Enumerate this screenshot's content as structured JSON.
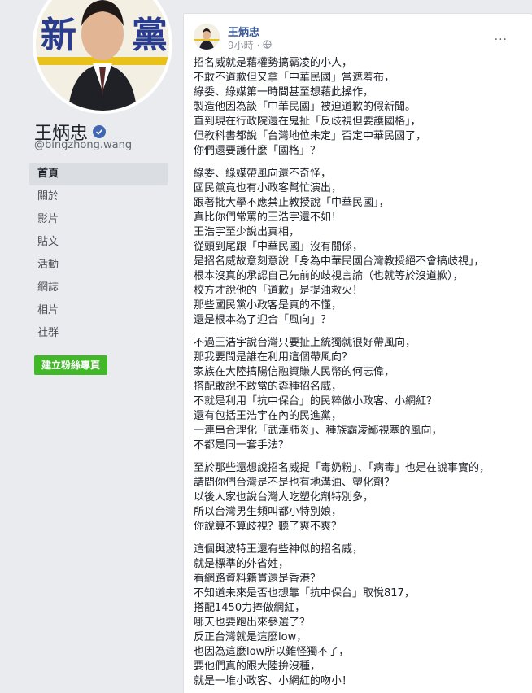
{
  "profile": {
    "name": "王炳忠",
    "handle": "@bingzhong.wang"
  },
  "nav": [
    {
      "label": "首頁",
      "active": true
    },
    {
      "label": "關於",
      "active": false
    },
    {
      "label": "影片",
      "active": false
    },
    {
      "label": "貼文",
      "active": false
    },
    {
      "label": "活動",
      "active": false
    },
    {
      "label": "網誌",
      "active": false
    },
    {
      "label": "相片",
      "active": false
    },
    {
      "label": "社群",
      "active": false
    }
  ],
  "create_page_button": "建立粉絲專頁",
  "post": {
    "author": "王炳忠",
    "time": "9小時",
    "more": "···",
    "paragraphs": [
      [
        "招名威就是藉權勢搞霸凌的小人，",
        "不敢不道歉但又拿「中華民國」當遮羞布，",
        "綠委、綠媒第一時間甚至想藉此操作，",
        "製造他因為談「中華民國」被迫道歉的假新聞。",
        "直到現在行政院還在鬼扯「反歧視但要護國格」，",
        "但教科書都說「台灣地位未定」否定中華民國了，",
        "你們還要護什麼「國格」？"
      ],
      [
        "綠委、綠媒帶風向還不奇怪，",
        "國民黨竟也有小政客幫忙演出，",
        "跟著批大學不應禁止教授說「中華民國」，",
        "真比你們常罵的王浩宇還不如！",
        "王浩宇至少說出真相，",
        "從頭到尾跟「中華民國」沒有關係，",
        "是招名威故意刻意說「身為中華民國台灣教授絕不會搞歧視」，",
        "根本沒真的承認自己先前的歧視言論（也就等於沒道歉），",
        "校方才說他的「道歉」是提油救火！",
        "那些國民黨小政客是真的不懂，",
        "還是根本為了迎合「風向」？"
      ],
      [
        "不過王浩宇說台灣只要扯上統獨就很好帶風向，",
        "那我要問是誰在利用這個帶風向？",
        "家族在大陸搞陽信融資賺人民幣的何志偉，",
        "搭配敢說不敢當的孬種招名威，",
        "不就是利用「抗中保台」的民粹做小政客、小網紅？",
        "還有包括王浩宇在內的民進黨，",
        "一連串合理化「武漢肺炎」、種族霸凌鄙視塞的風向，",
        "不都是同一套手法？"
      ],
      [
        "至於那些還想說招名威提「毒奶粉」、「病毒」也是在說事實的，",
        "請問你們台灣是不是也有地溝油、塑化劑？",
        "以後人家也說台灣人吃塑化劑特別多，",
        "所以台灣男生頻叫都小特別娘，",
        "你說算不算歧視？聽了爽不爽？"
      ],
      [
        "這個與波特王還有些神似的招名威，",
        "就是標準的外省姓，",
        "看網路資料籍貫還是香港？",
        "不知道未來是否也想靠「抗中保台」取悅817，",
        "搭配1450力捧做網紅，",
        "哪天也要跑出來參選了？",
        "反正台灣就是這麼low，",
        "也因為這麼low所以難怪獨不了，",
        "要他們真的跟大陸拚沒種，",
        "就是一堆小政客、小網紅的吻小！"
      ]
    ]
  },
  "colors": {
    "background": "#e9ebee",
    "link": "#385898",
    "verified": "#4267b2",
    "create_button": "#42b72a"
  },
  "icons": {
    "verified": "verified-badge-icon",
    "privacy": "globe-icon",
    "more": "more-options-icon"
  }
}
